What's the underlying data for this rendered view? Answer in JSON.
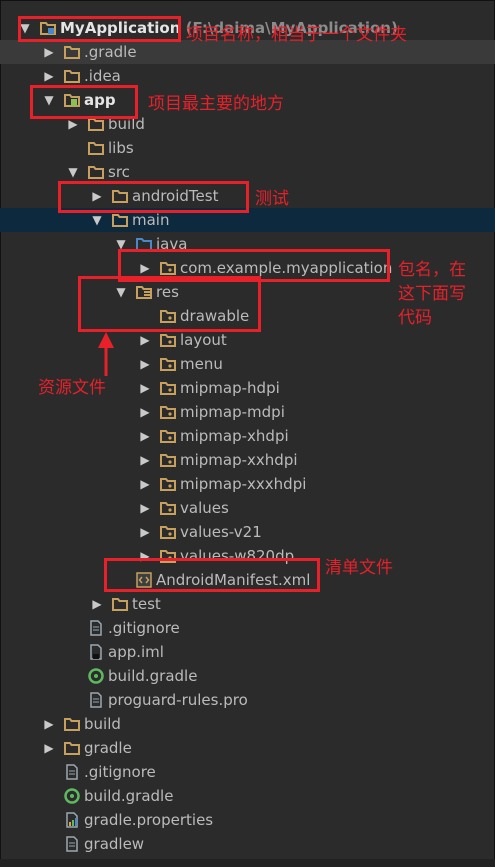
{
  "tree": {
    "rows": [
      {
        "label": "MyApplication",
        "path": " (F:\\daima\\MyApplication)",
        "icon": "project-icon",
        "arrow": "down",
        "indent": 0,
        "bold": true
      },
      {
        "label": ".gradle",
        "icon": "folder-icon",
        "arrow": "right",
        "indent": 1
      },
      {
        "label": ".idea",
        "icon": "folder-icon",
        "arrow": "right",
        "indent": 1
      },
      {
        "label": "app",
        "icon": "module-icon",
        "arrow": "down",
        "indent": 1,
        "bold": true
      },
      {
        "label": "build",
        "icon": "folder-icon",
        "arrow": "right",
        "indent": 2
      },
      {
        "label": "libs",
        "icon": "folder-icon",
        "arrow": "none",
        "indent": 2
      },
      {
        "label": "src",
        "icon": "folder-icon",
        "arrow": "down",
        "indent": 2
      },
      {
        "label": "androidTest",
        "icon": "folder-icon",
        "arrow": "right",
        "indent": 3
      },
      {
        "label": "main",
        "icon": "folder-icon",
        "arrow": "down",
        "indent": 3
      },
      {
        "label": "java",
        "icon": "source-folder-icon",
        "arrow": "down",
        "indent": 4
      },
      {
        "label": "com.example.myapplication",
        "icon": "package-icon",
        "arrow": "right",
        "indent": 5
      },
      {
        "label": "res",
        "icon": "resource-folder-icon",
        "arrow": "down",
        "indent": 4
      },
      {
        "label": "drawable",
        "icon": "package-icon",
        "arrow": "none",
        "indent": 5
      },
      {
        "label": "layout",
        "icon": "package-icon",
        "arrow": "right",
        "indent": 5
      },
      {
        "label": "menu",
        "icon": "package-icon",
        "arrow": "right",
        "indent": 5
      },
      {
        "label": "mipmap-hdpi",
        "icon": "package-icon",
        "arrow": "right",
        "indent": 5
      },
      {
        "label": "mipmap-mdpi",
        "icon": "package-icon",
        "arrow": "right",
        "indent": 5
      },
      {
        "label": "mipmap-xhdpi",
        "icon": "package-icon",
        "arrow": "right",
        "indent": 5
      },
      {
        "label": "mipmap-xxhdpi",
        "icon": "package-icon",
        "arrow": "right",
        "indent": 5
      },
      {
        "label": "mipmap-xxxhdpi",
        "icon": "package-icon",
        "arrow": "right",
        "indent": 5
      },
      {
        "label": "values",
        "icon": "package-icon",
        "arrow": "right",
        "indent": 5
      },
      {
        "label": "values-v21",
        "icon": "package-icon",
        "arrow": "right",
        "indent": 5
      },
      {
        "label": "values-w820dp",
        "icon": "package-icon",
        "arrow": "right",
        "indent": 5
      },
      {
        "label": "AndroidManifest.xml",
        "icon": "manifest-icon",
        "arrow": "none",
        "indent": 4
      },
      {
        "label": "test",
        "icon": "folder-icon",
        "arrow": "right",
        "indent": 3
      },
      {
        "label": ".gitignore",
        "icon": "text-file-icon",
        "arrow": "none",
        "indent": 2
      },
      {
        "label": "app.iml",
        "icon": "iml-file-icon",
        "arrow": "none",
        "indent": 2
      },
      {
        "label": "build.gradle",
        "icon": "gradle-icon",
        "arrow": "none",
        "indent": 2
      },
      {
        "label": "proguard-rules.pro",
        "icon": "text-file-icon",
        "arrow": "none",
        "indent": 2
      },
      {
        "label": "build",
        "icon": "folder-icon",
        "arrow": "right",
        "indent": 1
      },
      {
        "label": "gradle",
        "icon": "folder-icon",
        "arrow": "right",
        "indent": 1
      },
      {
        "label": ".gitignore",
        "icon": "text-file-icon",
        "arrow": "none",
        "indent": 1
      },
      {
        "label": "build.gradle",
        "icon": "gradle-icon",
        "arrow": "none",
        "indent": 1
      },
      {
        "label": "gradle.properties",
        "icon": "properties-icon",
        "arrow": "none",
        "indent": 1
      },
      {
        "label": "gradlew",
        "icon": "text-file-icon",
        "arrow": "none",
        "indent": 1
      }
    ],
    "highlighted_row": "main",
    "strip_row": ".gradle"
  },
  "annotations": {
    "project_name": "项目名称，相当于一个文件夹",
    "app_main": "项目最主要的地方",
    "test": "测试",
    "package": "包名，在\n这下面写\n代码",
    "resources": "资源文件",
    "manifest": "清单文件"
  },
  "colors": {
    "background": "#2b2b2b",
    "selection": "#0d293e",
    "annotation": "#e8202a",
    "folder": "#c6a05c",
    "text": "#bbbbbb"
  }
}
